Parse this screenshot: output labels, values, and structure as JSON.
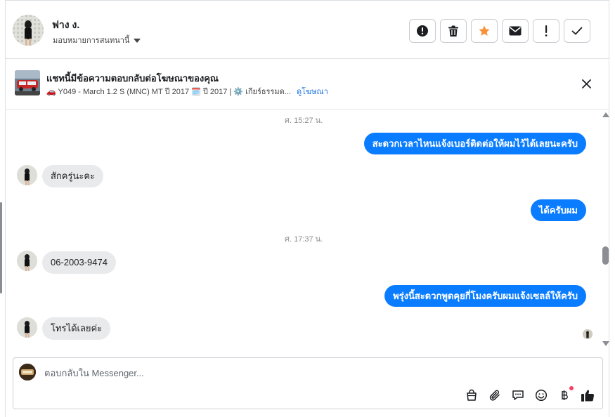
{
  "header": {
    "contact_name": "ฟาง ง.",
    "assign_label": "มอบหมายการสนทนานี้",
    "actions": [
      {
        "name": "report-spam-button",
        "icon": "alert-circle-icon"
      },
      {
        "name": "delete-button",
        "icon": "trash-icon"
      },
      {
        "name": "star-button",
        "icon": "star-icon"
      },
      {
        "name": "mark-unread-button",
        "icon": "envelope-icon"
      },
      {
        "name": "follow-up-button",
        "icon": "exclamation-icon"
      },
      {
        "name": "mark-done-button",
        "icon": "check-icon"
      }
    ]
  },
  "ad_banner": {
    "title": "แชทนี้มีข้อความตอบกลับต่อโฆษณาของคุณ",
    "subtitle": "🚗 Y049 - March 1.2 S (MNC) MT ปี 2017 🗓️ ปี 2017 | ⚙️ เกียร์ธรรมด...",
    "view_ad_link": "ดูโฆษณา"
  },
  "messages": [
    {
      "type": "time",
      "text": "ศ. 15:27 น."
    },
    {
      "type": "outgoing",
      "text": "สะดวกเวลาไหนแจ้งเบอร์ติดต่อให้ผมไว้ได้เลยนะครับ"
    },
    {
      "type": "incoming",
      "text": "สักครู่นะคะ"
    },
    {
      "type": "outgoing",
      "text": "ได้ครับผม"
    },
    {
      "type": "time",
      "text": "ศ. 17:37 น."
    },
    {
      "type": "incoming",
      "text": "06-2003-9474"
    },
    {
      "type": "outgoing",
      "text": "พรุ่งนี้สะดวกพูดคุยกี่โมงครับผมแจ้งเซลล์ให้ครับ"
    },
    {
      "type": "incoming",
      "text": "โทรได้เลยค่ะ"
    }
  ],
  "composer": {
    "placeholder": "ตอบกลับใน Messenger...",
    "tools": [
      "shopping-bag-icon",
      "paperclip-icon",
      "saved-reply-icon",
      "emoji-icon",
      "baht-payment-icon",
      "thumbs-up-icon"
    ]
  },
  "colors": {
    "accent": "#0a7cff",
    "star": "#f7923b",
    "incoming_bubble": "#e9eaec",
    "link": "#1b74e4",
    "notification_dot": "#fa3e5f"
  }
}
